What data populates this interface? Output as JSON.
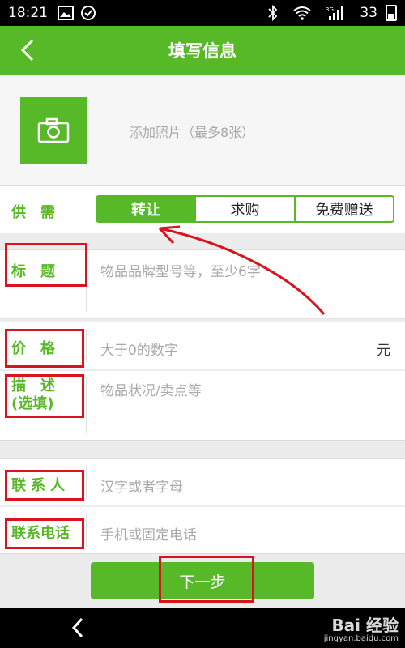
{
  "status_bar": {
    "time": "18:21",
    "network_label": "3G",
    "battery": "33",
    "left_icons": [
      "image-icon",
      "check-circle-icon"
    ],
    "right_icons": [
      "bluetooth-icon",
      "wifi-icon",
      "signal-icon",
      "battery-icon"
    ]
  },
  "header": {
    "back_icon": "chevron-left-icon",
    "title": "填写信息"
  },
  "photo": {
    "icon": "camera-icon",
    "hint": "添加照片（最多8张）"
  },
  "form": {
    "supply_demand": {
      "label": "供　需",
      "options": [
        "转让",
        "求购",
        "免费赠送"
      ],
      "selected": "转让"
    },
    "title": {
      "label": "标　题",
      "placeholder": "物品品牌型号等，至少6字"
    },
    "price": {
      "label": "价　格",
      "placeholder": "大于0的数字",
      "unit": "元"
    },
    "description": {
      "label_line1": "描　述",
      "label_line2": "(选填)",
      "placeholder": "物品状况/卖点等"
    },
    "contact": {
      "label": "联系人",
      "placeholder": "汉字或者字母"
    },
    "phone": {
      "label": "联系电话",
      "placeholder": "手机或固定电话"
    }
  },
  "next_button": "下一步",
  "nav": {
    "back_icon": "triangle-back-icon"
  },
  "watermark": {
    "main": "Bai 经验",
    "sub": "jingyan.baidu.com"
  },
  "colors": {
    "accent": "#57b927",
    "annotation": "#d9141d"
  }
}
